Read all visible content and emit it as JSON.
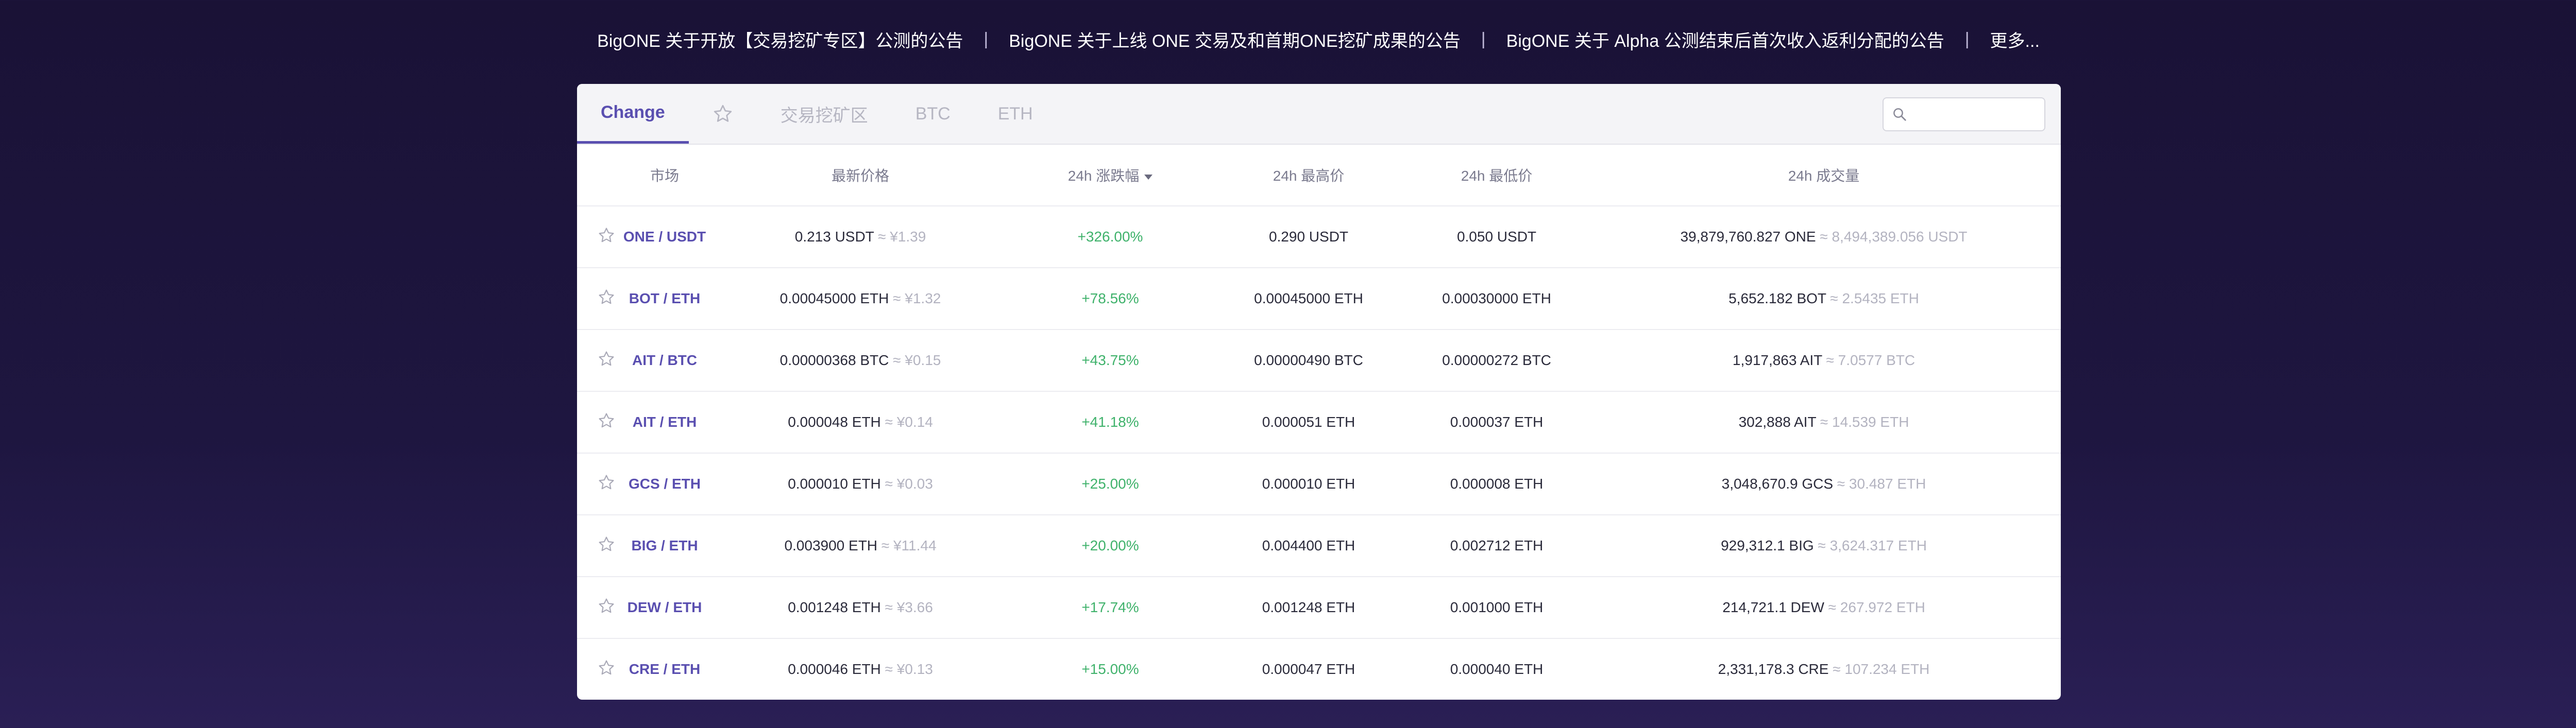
{
  "announcements": [
    {
      "text": "BigONE 关于开放【交易挖矿专区】公测的公告"
    },
    {
      "text": "BigONE 关于上线 ONE 交易及和首期ONE挖矿成果的公告"
    },
    {
      "text": "BigONE 关于 Alpha 公测结束后首次收入返利分配的公告"
    },
    {
      "text": "更多..."
    }
  ],
  "separator": "|",
  "tabs": [
    {
      "label": "Change",
      "active": true
    },
    {
      "label": "",
      "icon": "star-icon"
    },
    {
      "label": "交易挖矿区"
    },
    {
      "label": "BTC"
    },
    {
      "label": "ETH"
    }
  ],
  "search": {
    "placeholder": "",
    "value": ""
  },
  "columns": {
    "market": "市场",
    "price": "最新价格",
    "change": "24h 涨跌幅",
    "high": "24h 最高价",
    "low": "24h 最低价",
    "volume": "24h 成交量"
  },
  "rows": [
    {
      "market": "ONE / USDT",
      "price": "0.213 USDT",
      "price_alt": "≈ ¥1.39",
      "change": "+326.00%",
      "high": "0.290 USDT",
      "low": "0.050 USDT",
      "volume": "39,879,760.827 ONE",
      "volume_alt": "≈ 8,494,389.056 USDT"
    },
    {
      "market": "BOT / ETH",
      "price": "0.00045000 ETH",
      "price_alt": "≈ ¥1.32",
      "change": "+78.56%",
      "high": "0.00045000 ETH",
      "low": "0.00030000 ETH",
      "volume": "5,652.182 BOT",
      "volume_alt": "≈ 2.5435 ETH"
    },
    {
      "market": "AIT / BTC",
      "price": "0.00000368 BTC",
      "price_alt": "≈ ¥0.15",
      "change": "+43.75%",
      "high": "0.00000490 BTC",
      "low": "0.00000272 BTC",
      "volume": "1,917,863 AIT",
      "volume_alt": "≈ 7.0577 BTC"
    },
    {
      "market": "AIT / ETH",
      "price": "0.000048 ETH",
      "price_alt": "≈ ¥0.14",
      "change": "+41.18%",
      "high": "0.000051 ETH",
      "low": "0.000037 ETH",
      "volume": "302,888 AIT",
      "volume_alt": "≈ 14.539 ETH"
    },
    {
      "market": "GCS / ETH",
      "price": "0.000010 ETH",
      "price_alt": "≈ ¥0.03",
      "change": "+25.00%",
      "high": "0.000010 ETH",
      "low": "0.000008 ETH",
      "volume": "3,048,670.9 GCS",
      "volume_alt": "≈ 30.487 ETH"
    },
    {
      "market": "BIG / ETH",
      "price": "0.003900 ETH",
      "price_alt": "≈ ¥11.44",
      "change": "+20.00%",
      "high": "0.004400 ETH",
      "low": "0.002712 ETH",
      "volume": "929,312.1 BIG",
      "volume_alt": "≈ 3,624.317 ETH"
    },
    {
      "market": "DEW / ETH",
      "price": "0.001248 ETH",
      "price_alt": "≈ ¥3.66",
      "change": "+17.74%",
      "high": "0.001248 ETH",
      "low": "0.001000 ETH",
      "volume": "214,721.1 DEW",
      "volume_alt": "≈ 267.972 ETH"
    },
    {
      "market": "CRE / ETH",
      "price": "0.000046 ETH",
      "price_alt": "≈ ¥0.13",
      "change": "+15.00%",
      "high": "0.000047 ETH",
      "low": "0.000040 ETH",
      "volume": "2,331,178.3 CRE",
      "volume_alt": "≈ 107.234 ETH"
    }
  ],
  "colors": {
    "accent": "#5a4fb0",
    "positive": "#3fb26b",
    "muted": "#b3b3c0"
  }
}
